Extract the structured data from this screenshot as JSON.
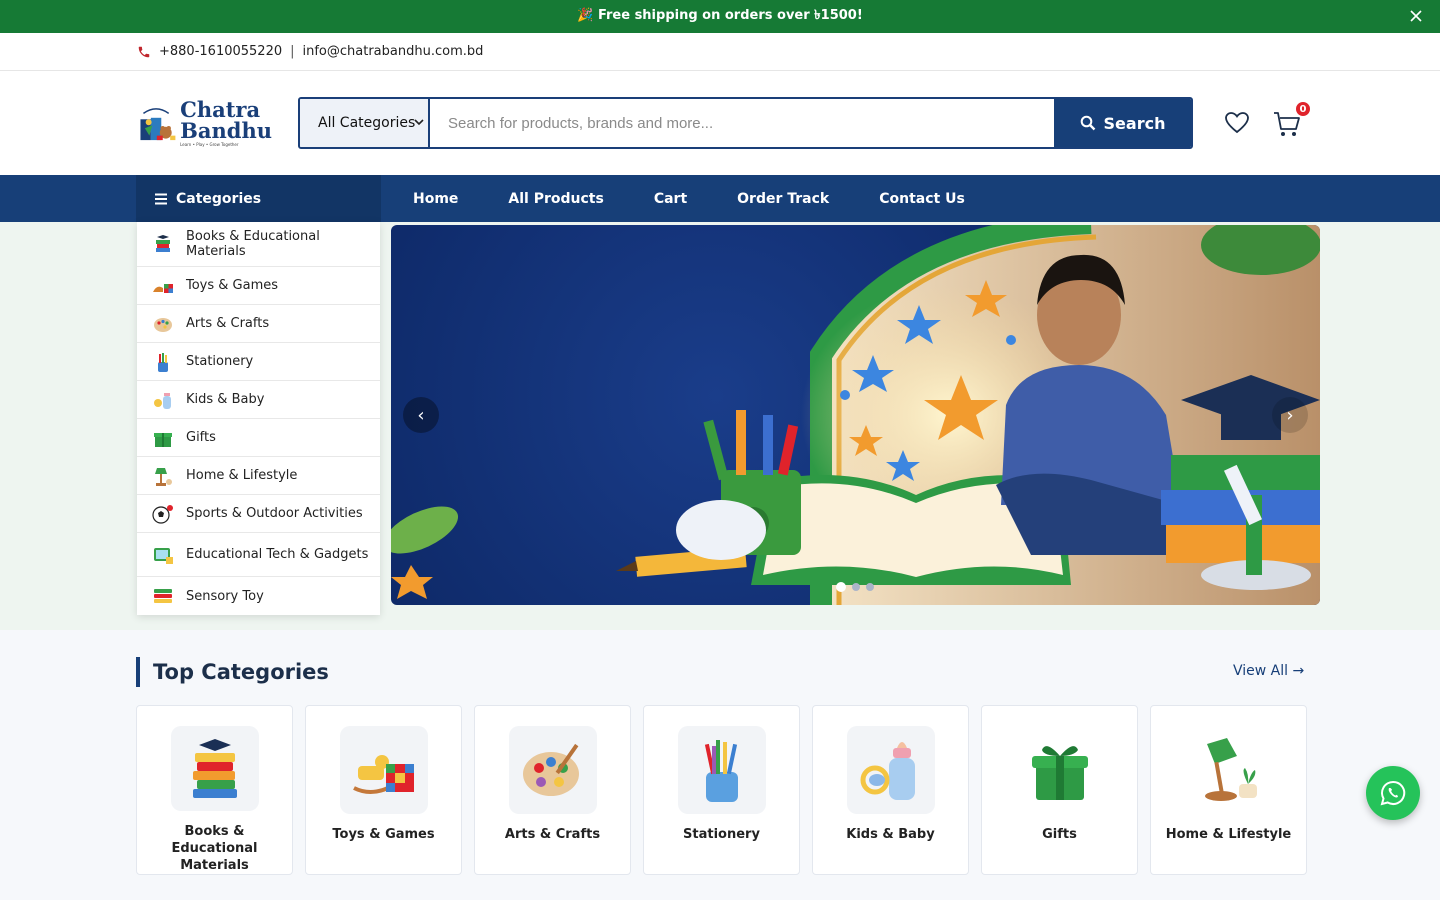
{
  "promo": {
    "text": "🎉 Free shipping on orders over ৳1500!"
  },
  "contact": {
    "phone": "+880-1610055220",
    "separator": "|",
    "email": "info@chatrabandhu.com.bd"
  },
  "logo": {
    "line1": "Chatra",
    "line2": "Bandhu",
    "tagline": "Learn • Play • Grow Together"
  },
  "search": {
    "category": "All Categories",
    "placeholder": "Search for products, brands and more...",
    "button_label": "Search"
  },
  "cart": {
    "count": "0"
  },
  "nav": {
    "categories_label": "Categories",
    "links": [
      "Home",
      "All Products",
      "Cart",
      "Order Track",
      "Contact Us"
    ]
  },
  "sidebar_categories": [
    "Books & Educational Materials",
    "Toys & Games",
    "Arts & Crafts",
    "Stationery",
    "Kids & Baby",
    "Gifts",
    "Home & Lifestyle",
    "Sports & Outdoor Activities",
    "Educational Tech & Gadgets",
    "Sensory Toy"
  ],
  "slider": {
    "prev": "‹",
    "next": "›",
    "active_slide": 1,
    "slide_count": 3
  },
  "top_categories": {
    "title": "Top Categories",
    "view_all": "View All →",
    "items": [
      "Books & Educational Materials",
      "Toys & Games",
      "Arts & Crafts",
      "Stationery",
      "Kids & Baby",
      "Gifts",
      "Home & Lifestyle"
    ]
  },
  "colors": {
    "primary": "#173f78",
    "promo_green": "#167a35",
    "whatsapp": "#25c35a",
    "badge_red": "#e0232b"
  }
}
